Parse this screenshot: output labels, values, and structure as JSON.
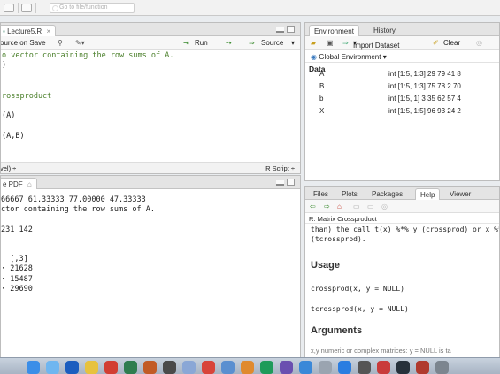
{
  "topbar": {
    "goto_placeholder": "Go to file/function"
  },
  "source": {
    "tab_label": "Lecture5.R",
    "tab_close": "×",
    "toolbar": {
      "source_on_save": "ource on Save",
      "run": "Run",
      "source": "Source"
    },
    "lines": [
      {
        "text": "o vector containing the row sums of A.",
        "comment": true
      },
      {
        "text": ")",
        "comment": false
      },
      {
        "text": "",
        "comment": false
      },
      {
        "text": "",
        "comment": false
      },
      {
        "text": "rossproduct",
        "comment": true
      },
      {
        "text": "",
        "comment": false
      },
      {
        "text": "(A)",
        "comment": false
      },
      {
        "text": "",
        "comment": false
      },
      {
        "text": "(A,B)",
        "comment": false
      }
    ],
    "status_left": "vel) ÷",
    "status_right": "R Script ÷"
  },
  "console": {
    "tab_label": "e PDF",
    "lines": [
      "66667 61.33333 77.00000 47.33333",
      "ctor containing the row sums of A.",
      "",
      "231 142",
      "",
      "",
      "  [,3]",
      "· 21628",
      "· 15487",
      "· 29690"
    ]
  },
  "environment": {
    "tabs": [
      "Environment",
      "History"
    ],
    "toolbar": {
      "import": "Import Dataset",
      "clear": "Clear"
    },
    "scope": "Global Environment",
    "section": "Data",
    "rows": [
      {
        "name": "A",
        "value": "int [1:5, 1:3] 29 79 41 8"
      },
      {
        "name": "B",
        "value": "int [1:5, 1:3] 75 78 2 70"
      },
      {
        "name": "b",
        "value": "int [1:5, 1] 3 35 62 57 4"
      },
      {
        "name": "X",
        "value": "int [1:5, 1:5] 96 93 24 2"
      }
    ]
  },
  "help": {
    "tabs": [
      "Files",
      "Plots",
      "Packages",
      "Help",
      "Viewer"
    ],
    "topic": "R: Matrix Crossproduct",
    "intro_line1": "than) the call t(x) %*% y (crossprod) or x %*",
    "intro_line2": "(tcrossprod).",
    "usage_heading": "Usage",
    "usage1": "crossprod(x, y = NULL)",
    "usage2": "tcrossprod(x, y = NULL)",
    "args_heading": "Arguments",
    "args_line": "x,y   numeric or complex matrices: y = NULL is ta"
  },
  "colors": {
    "run_green": "#3a8b2e",
    "comment_green": "#4a7f2a"
  }
}
